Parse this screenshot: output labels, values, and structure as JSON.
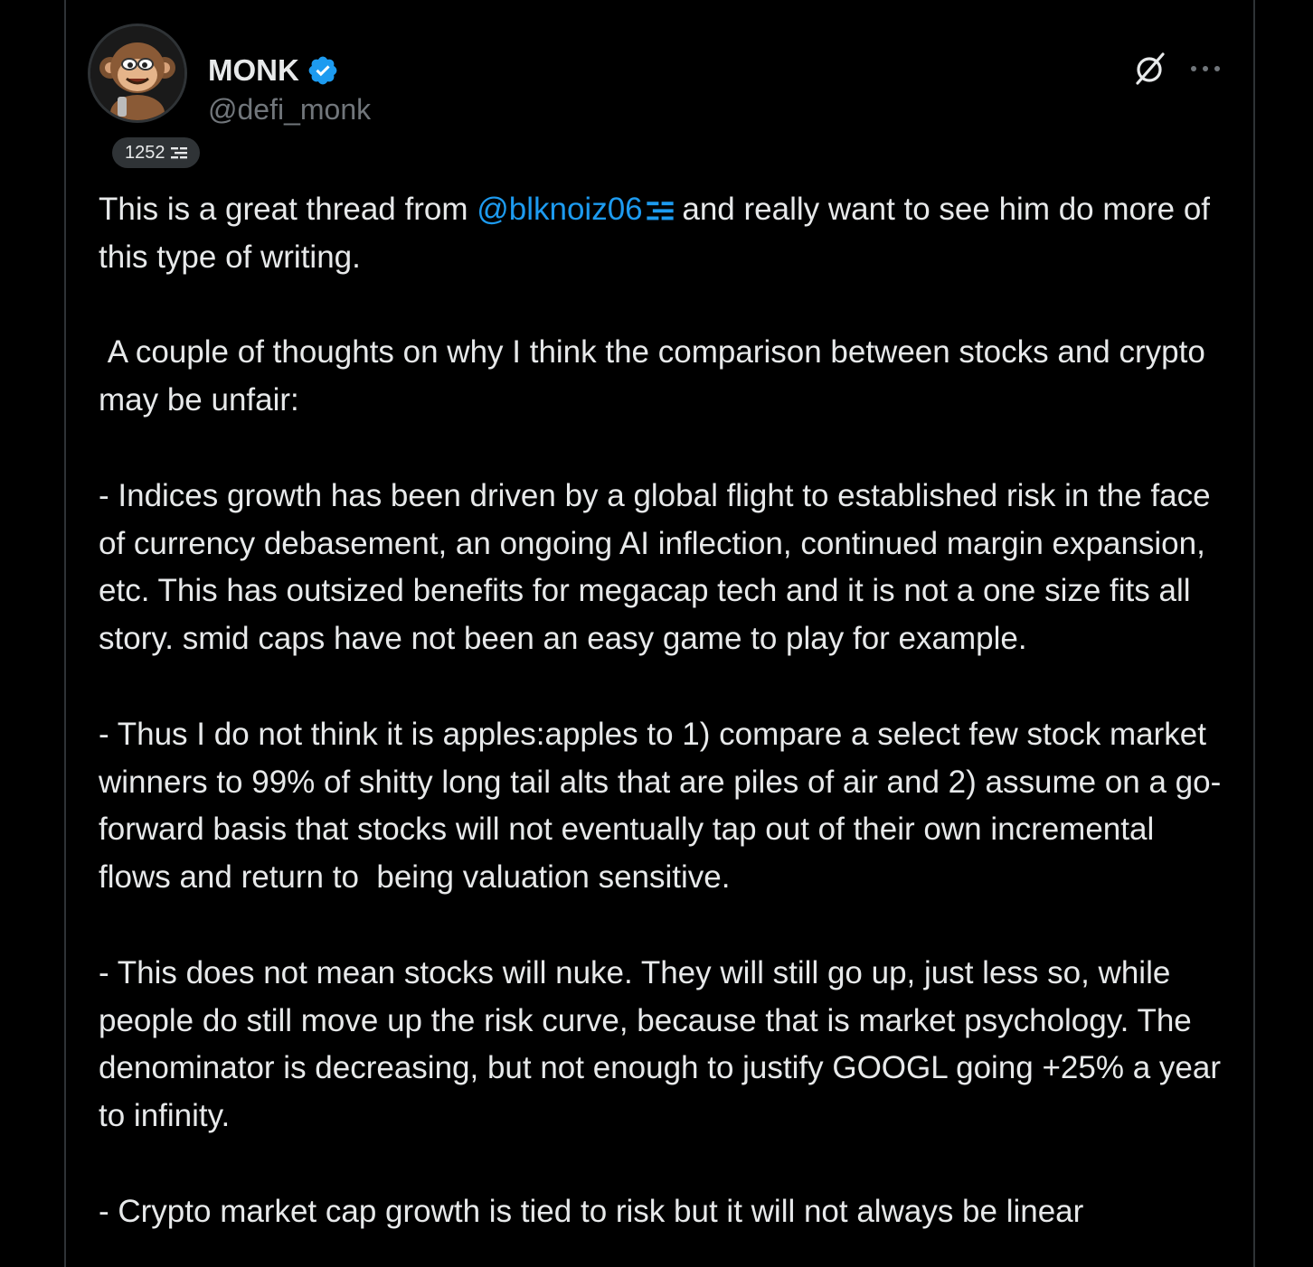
{
  "author": {
    "name": "MONK",
    "handle": "@defi_monk",
    "badge_count": "1252",
    "verified": true
  },
  "header_icons": [
    "grok-icon",
    "more-options-icon"
  ],
  "post": {
    "text_before_mention": "This is a great thread from ",
    "mention": "@blknoiz06",
    "text_after_mention": " and really want to see him do more of this type of writing.\n\n A couple of thoughts on why I think the comparison between stocks and crypto may be unfair:\n\n- Indices growth has been driven by a global flight to established risk in the face of currency debasement, an ongoing AI inflection, continued margin expansion, etc. This has outsized benefits for megacap tech and it is not a one size fits all story. smid caps have not been an easy game to play for example.\n\n- Thus I do not think it is apples:apples to 1) compare a select few stock market winners to 99% of shitty long tail alts that are piles of air and 2) assume on a go-forward basis that stocks will not eventually tap out of their own incremental flows and return to  being valuation sensitive.\n\n- This does not mean stocks will nuke. They will still go up, just less so, while people do still move up the risk curve, because that is market psychology. The denominator is decreasing, but not enough to justify GOOGL going +25% a year to infinity.\n\n- Crypto market cap growth is tied to risk but it will not always be linear"
  },
  "colors": {
    "background": "#000000",
    "text": "#e7e9ea",
    "secondary_text": "#71767b",
    "accent": "#1d9bf0",
    "border": "#2f3336"
  }
}
